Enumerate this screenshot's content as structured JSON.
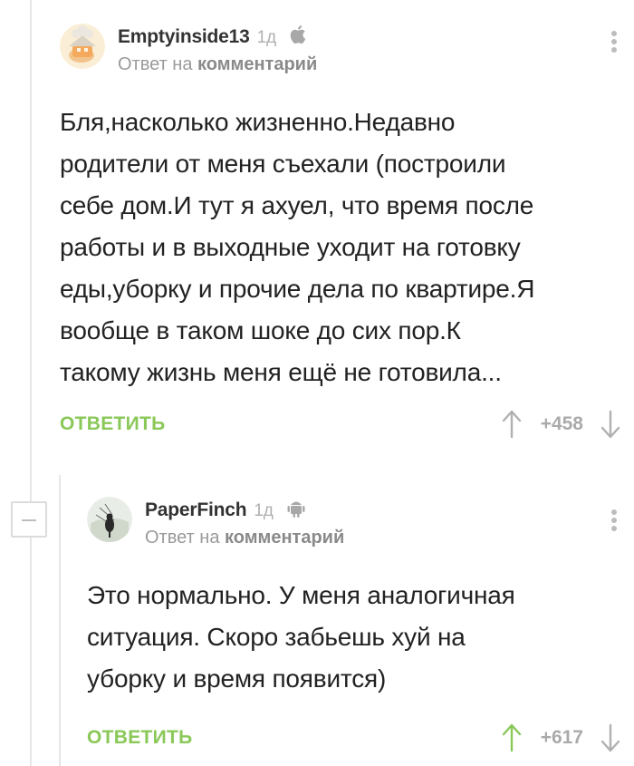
{
  "thread": {
    "comments": [
      {
        "author": "Emptyinside13",
        "time": "1д",
        "platform_icon": "apple-icon",
        "reply_prefix": "Ответ на",
        "reply_target": "комментарий",
        "text": "Бля,насколько жизненно.Недавно\nродители от меня съехали (построили\nсебе дом.И тут я ахуел, что время после\nработы и в выходные уходит на готовку\nеды,уборку и прочие дела по квартире.Я\nвообще в таком шоке до сих пор.К\nтакому жизнь меня ещё не готовила...",
        "reply_label": "ОТВЕТИТЬ",
        "score": "+458",
        "upvote_color": "#b0b0b0"
      },
      {
        "author": "PaperFinch",
        "time": "1д",
        "platform_icon": "android-icon",
        "reply_prefix": "Ответ на",
        "reply_target": "комментарий",
        "text": "Это нормально. У меня аналогичная\nситуация. Скоро забьешь хуй на\nуборку и время появится)",
        "reply_label": "ОТВЕТИТЬ",
        "score": "+617",
        "upvote_color": "#8ac858"
      }
    ]
  },
  "colors": {
    "accent_green": "#8ac858",
    "muted_gray": "#b0b0b0",
    "text": "#222222"
  }
}
